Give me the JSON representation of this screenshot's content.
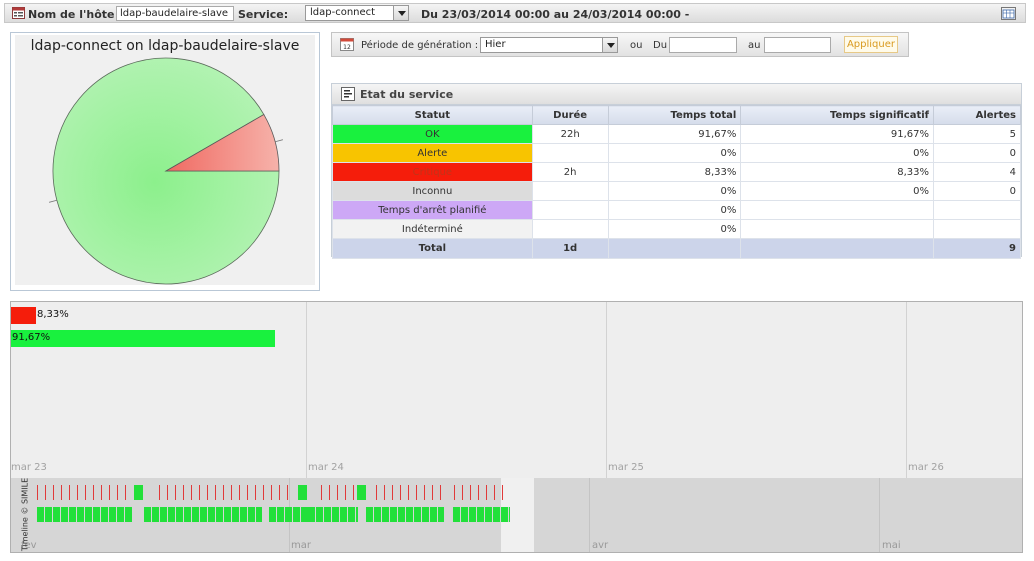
{
  "toolbar": {
    "host_label": "Nom de l'hôte :",
    "host_value": "ldap-baudelaire-slave",
    "service_label": "Service:",
    "service_value": "ldap-connect",
    "date_range": "Du 23/03/2014 00:00 au 24/03/2014 00:00 -"
  },
  "pie": {
    "title": "ldap-connect on ldap-baudelaire-slave",
    "slices": [
      {
        "status": "OK",
        "percent": 91.67,
        "color": "#9ff39f"
      },
      {
        "status": "Critique",
        "percent": 8.33,
        "color": "#f48a80"
      }
    ]
  },
  "period": {
    "label": "Période de génération :",
    "selected": "Hier",
    "or_label": "ou",
    "from_label": "Du",
    "from_value": "",
    "to_label": "au",
    "to_value": "",
    "apply_label": "Appliquer"
  },
  "state": {
    "title": "Etat du service",
    "columns": [
      "Statut",
      "Durée",
      "Temps total",
      "Temps significatif",
      "Alertes"
    ],
    "rows": [
      {
        "status": "OK",
        "color": "#19f13e",
        "text_color": "#333333",
        "duration": "22h",
        "total_time": "91,67%",
        "significant_time": "91,67%",
        "alerts": "5"
      },
      {
        "status": "Alerte",
        "color": "#f8c400",
        "text_color": "#333333",
        "duration": "",
        "total_time": "0%",
        "significant_time": "0%",
        "alerts": "0"
      },
      {
        "status": "Critique",
        "color": "#f51d0b",
        "text_color": "#c0341a",
        "duration": "2h",
        "total_time": "8,33%",
        "significant_time": "8,33%",
        "alerts": "4"
      },
      {
        "status": "Inconnu",
        "color": "#dcdcdc",
        "text_color": "#333333",
        "duration": "",
        "total_time": "0%",
        "significant_time": "0%",
        "alerts": "0"
      },
      {
        "status": "Temps d'arrêt planifié",
        "color": "#cda8f6",
        "text_color": "#333333",
        "duration": "",
        "total_time": "0%",
        "significant_time": "",
        "alerts": ""
      },
      {
        "status": "Indéterminé",
        "color": "#f2f2f2",
        "text_color": "#333333",
        "duration": "",
        "total_time": "0%",
        "significant_time": "",
        "alerts": ""
      }
    ],
    "total": {
      "label": "Total",
      "duration": "1d",
      "alerts": "9"
    }
  },
  "timeline": {
    "bars": [
      {
        "label": "8,33%",
        "percent": 8.33,
        "color": "#f51d0b"
      },
      {
        "label": "91,67%",
        "percent": 91.67,
        "color": "#19f13e"
      }
    ],
    "days": [
      "mar 23",
      "mar 24",
      "mar 25",
      "mar 26"
    ],
    "months": [
      "fev",
      "mar",
      "avr",
      "mai"
    ],
    "credit": "Timeline © SIMILE"
  }
}
